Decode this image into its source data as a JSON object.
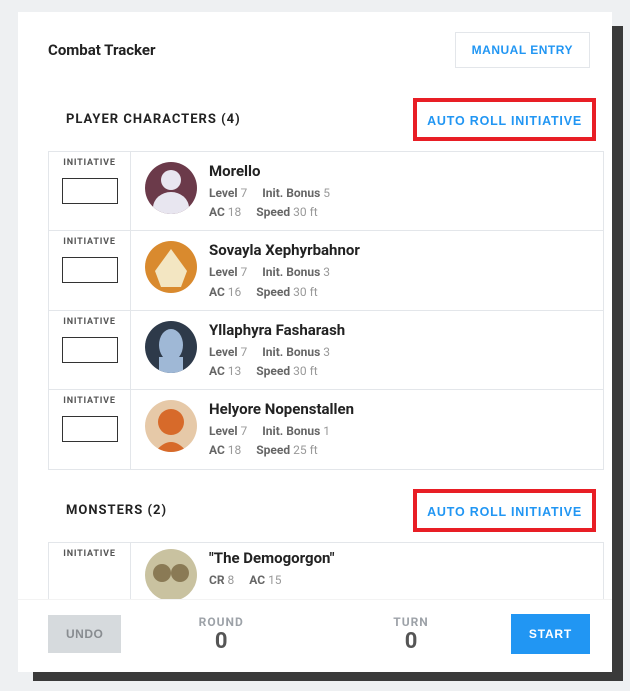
{
  "title": "Combat Tracker",
  "manual_entry": "MANUAL ENTRY",
  "pc_section": {
    "label": "PLAYER CHARACTERS (4)",
    "auto_roll": "AUTO ROLL INITIATIVE"
  },
  "monster_section": {
    "label": "MONSTERS (2)",
    "auto_roll": "AUTO ROLL INITIATIVE"
  },
  "init_label": "INITIATIVE",
  "stat_labels": {
    "level": "Level",
    "ac": "AC",
    "init_bonus": "Init. Bonus",
    "speed": "Speed",
    "cr": "CR"
  },
  "pcs": [
    {
      "name": "Morello",
      "level": "7",
      "ac": "18",
      "init_bonus": "5",
      "speed": "30 ft"
    },
    {
      "name": "Sovayla Xephyrbahnor",
      "level": "7",
      "ac": "16",
      "init_bonus": "3",
      "speed": "30 ft"
    },
    {
      "name": "Yllaphyra Fasharash",
      "level": "7",
      "ac": "13",
      "init_bonus": "3",
      "speed": "30 ft"
    },
    {
      "name": "Helyore Nopenstallen",
      "level": "7",
      "ac": "18",
      "init_bonus": "1",
      "speed": "25 ft"
    }
  ],
  "monsters": [
    {
      "name": "\"The Demogorgon\"",
      "cr": "8",
      "ac": "15"
    }
  ],
  "footer": {
    "undo": "UNDO",
    "round_label": "ROUND",
    "round_value": "0",
    "turn_label": "TURN",
    "turn_value": "0",
    "start": "START"
  },
  "avatar_colors": {
    "0": {
      "bg": "#6b3a4a",
      "fg": "#e8e6f0"
    },
    "1": {
      "bg": "#d98a2e",
      "fg": "#f3e6c2"
    },
    "2": {
      "bg": "#2e3a4a",
      "fg": "#9fb8d6"
    },
    "3": {
      "bg": "#e6c9a8",
      "fg": "#d76a2a"
    },
    "m0": {
      "bg": "#c9c2a0",
      "fg": "#8a7a55"
    }
  }
}
